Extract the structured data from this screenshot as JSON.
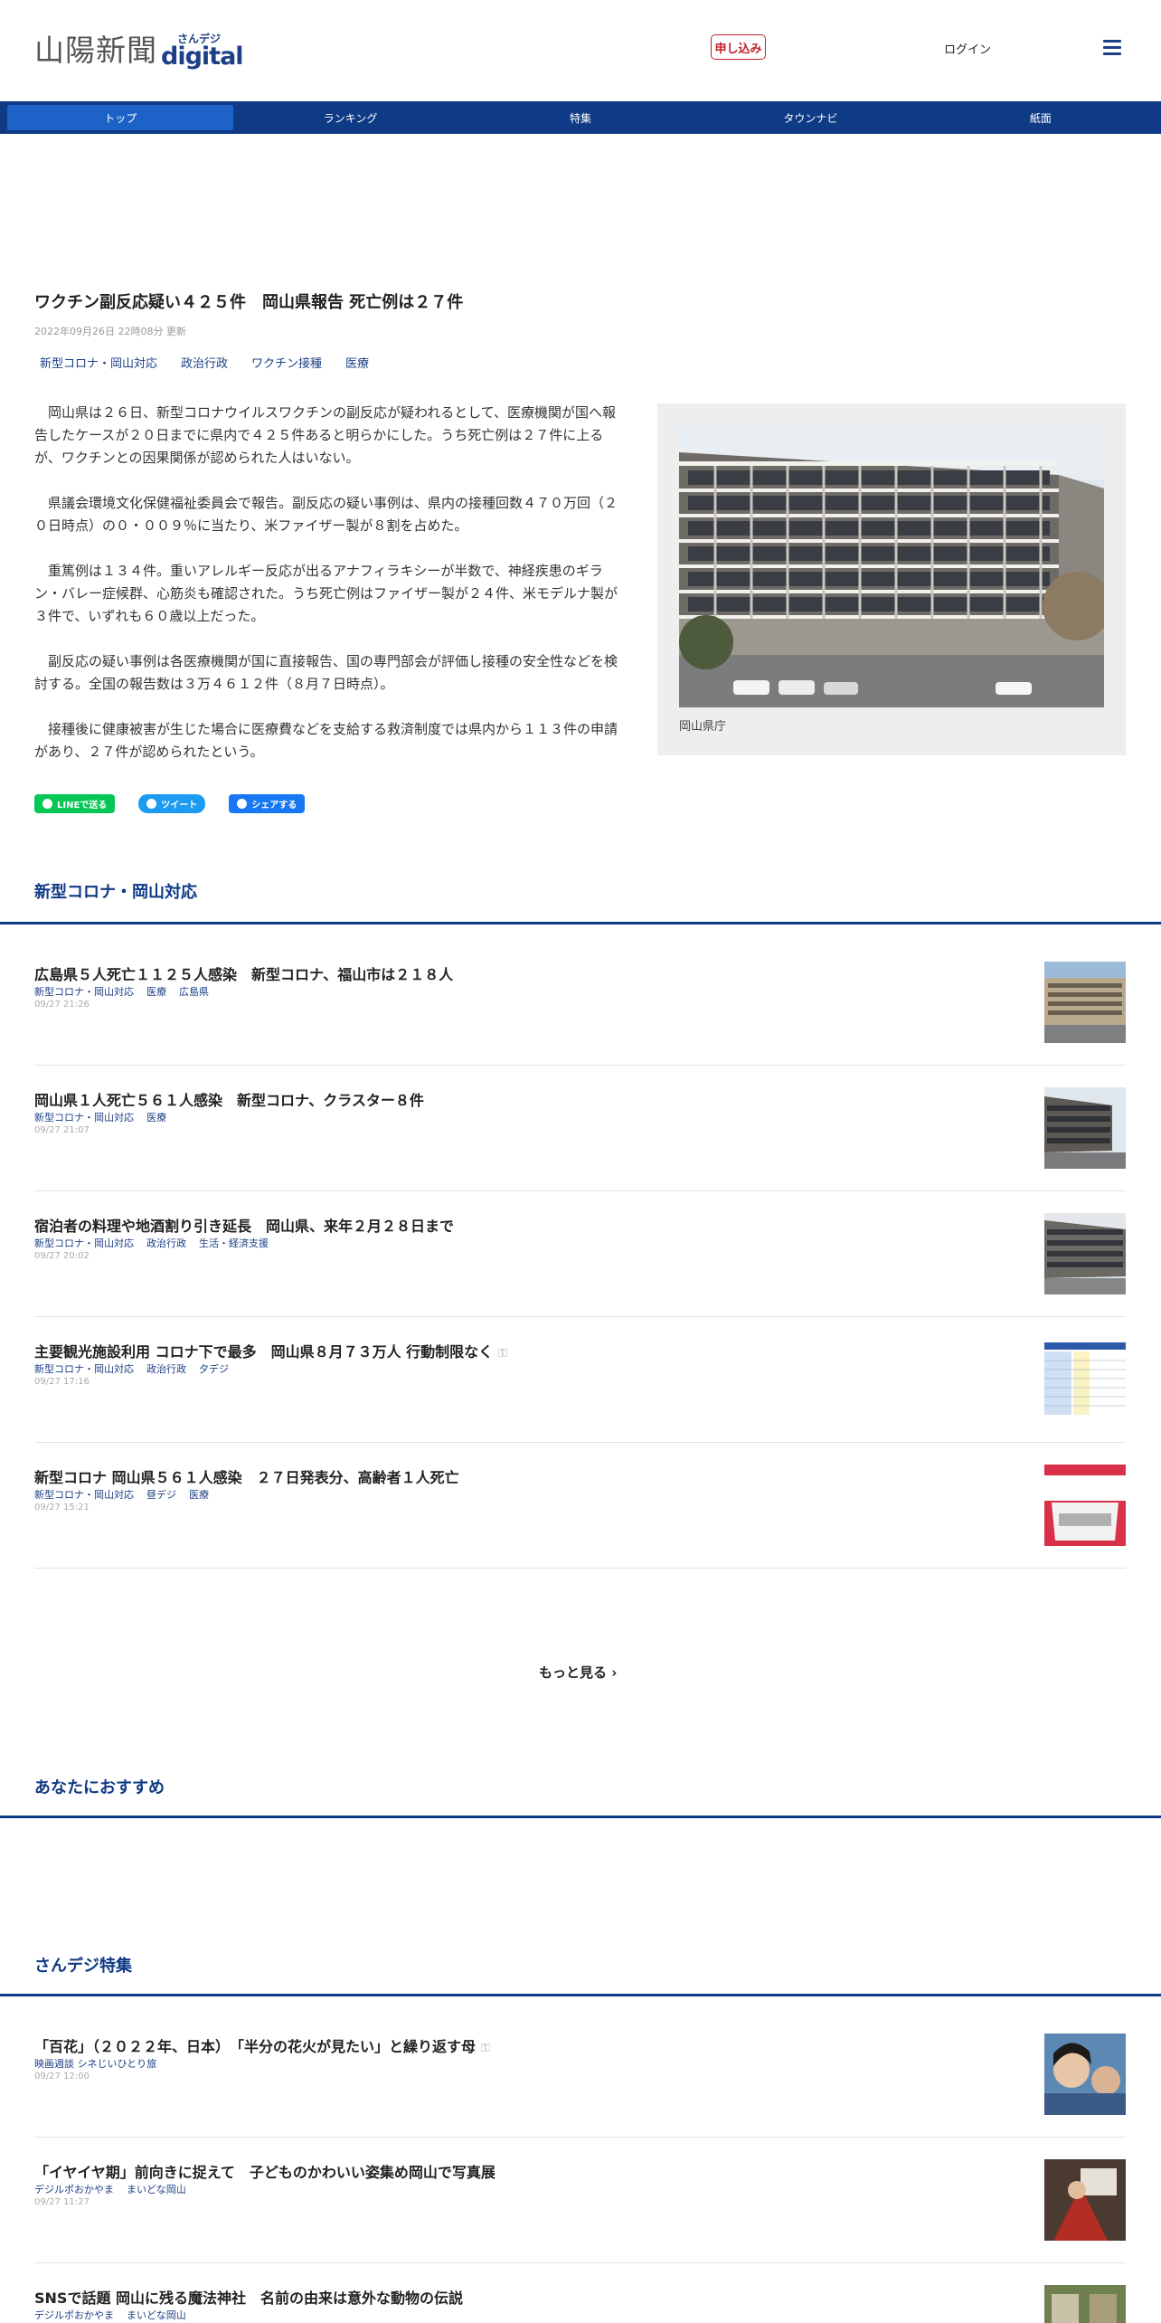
{
  "header": {
    "logo_main": "山陽新聞",
    "logo_sub_small": "さんデジ",
    "logo_sub_big": "digital",
    "apply_label": "申し込み",
    "login_label": "ログイン",
    "menu_icon": "hamburger-icon"
  },
  "nav": {
    "items": [
      {
        "label": "トップ"
      },
      {
        "label": "ランキング"
      },
      {
        "label": "特集"
      },
      {
        "label": "タウンナビ"
      },
      {
        "label": "紙面"
      }
    ],
    "active_index": 0
  },
  "article": {
    "title": "ワクチン副反応疑い４２５件　岡山県報告 死亡例は２７件",
    "date": "2022年09月26日 22時08分 更新",
    "tags": [
      "新型コロナ・岡山対応",
      "政治行政",
      "ワクチン接種",
      "医療"
    ],
    "paragraphs": [
      "岡山県は２６日、新型コロナウイルスワクチンの副反応が疑われるとして、医療機関が国へ報告したケースが２０日までに県内で４２５件あると明らかにした。うち死亡例は２７件に上るが、ワクチンとの因果関係が認められた人はいない。",
      "県議会環境文化保健福祉委員会で報告。副反応の疑い事例は、県内の接種回数４７０万回（２０日時点）の０・００９％に当たり、米ファイザー製が８割を占めた。",
      "重篤例は１３４件。重いアレルギー反応が出るアナフィラキシーが半数で、神経疾患のギラン・バレー症候群、心筋炎も確認された。うち死亡例はファイザー製が２４件、米モデルナ製が３件で、いずれも６０歳以上だった。",
      "副反応の疑い事例は各医療機関が国に直接報告、国の専門部会が評価し接種の安全性などを検討する。全国の報告数は３万４６１２件（８月７日時点）。",
      "接種後に健康被害が生じた場合に医療費などを支給する救済制度では県内から１１３件の申請があり、２７件が認められたという。"
    ],
    "photo_caption": "岡山県庁",
    "share": {
      "line_label": "LINEで送る",
      "tweet_label": "ツイート",
      "facebook_label": "シェアする"
    }
  },
  "corona_section": {
    "title": "新型コロナ・岡山対応",
    "items": [
      {
        "title": "広島県５人死亡１１２５人感染　新型コロナ、福山市は２１８人",
        "tags": [
          "新型コロナ・岡山対応",
          "医療",
          "広島県"
        ],
        "time": "09/27 21:26",
        "thumb": "building",
        "locked": false
      },
      {
        "title": "岡山県１人死亡５６１人感染　新型コロナ、クラスター８件",
        "tags": [
          "新型コロナ・岡山対応",
          "医療"
        ],
        "time": "09/27 21:07",
        "thumb": "building",
        "locked": false
      },
      {
        "title": "宿泊者の料理や地酒割り引き延長　岡山県、来年２月２８日まで",
        "tags": [
          "新型コロナ・岡山対応",
          "政治行政",
          "生活・経済支援"
        ],
        "time": "09/27 20:02",
        "thumb": "building",
        "locked": false
      },
      {
        "title": "主要観光施設利用 コロナ下で最多　岡山県８月７３万人 行動制限なく",
        "tags": [
          "新型コロナ・岡山対応",
          "政治行政",
          "夕デジ"
        ],
        "time": "09/27 17:16",
        "thumb": "table",
        "locked": true
      },
      {
        "title": "新型コロナ 岡山県５６１人感染　２７日発表分、高齢者１人死亡",
        "tags": [
          "新型コロナ・岡山対応",
          "昼デジ",
          "医療"
        ],
        "time": "09/27 15:21",
        "thumb": "text",
        "locked": false
      }
    ],
    "more_label": "もっと見る"
  },
  "recommend_section": {
    "title": "あなたにおすすめ"
  },
  "feature_section": {
    "title": "さんデジ特集",
    "items": [
      {
        "title": "「百花」（２０２２年、日本）　「半分の花火が見たい」と繰り返す母",
        "tags": [
          "映画週談 シネじいひとり旅"
        ],
        "time": "09/27 12:00",
        "thumb": "people",
        "locked": true
      },
      {
        "title": "「イヤイヤ期」前向きに捉えて　子どものかわいい姿集め岡山で写真展",
        "tags": [
          "デジルポおかやま",
          "まいどな岡山"
        ],
        "time": "09/27 11:27",
        "thumb": "photo",
        "locked": false
      },
      {
        "title": "SNSで話題 岡山に残る魔法神社　名前の由来は意外な動物の伝説",
        "tags": [
          "デジルポおかやま",
          "まいどな岡山"
        ],
        "time": "",
        "thumb": "shrine",
        "locked": false
      }
    ]
  },
  "colors": {
    "brand_blue": "#0f3a86",
    "nav_active": "#1d62c7",
    "apply_red": "#c0212b",
    "tag_blue": "#1d3f86"
  }
}
